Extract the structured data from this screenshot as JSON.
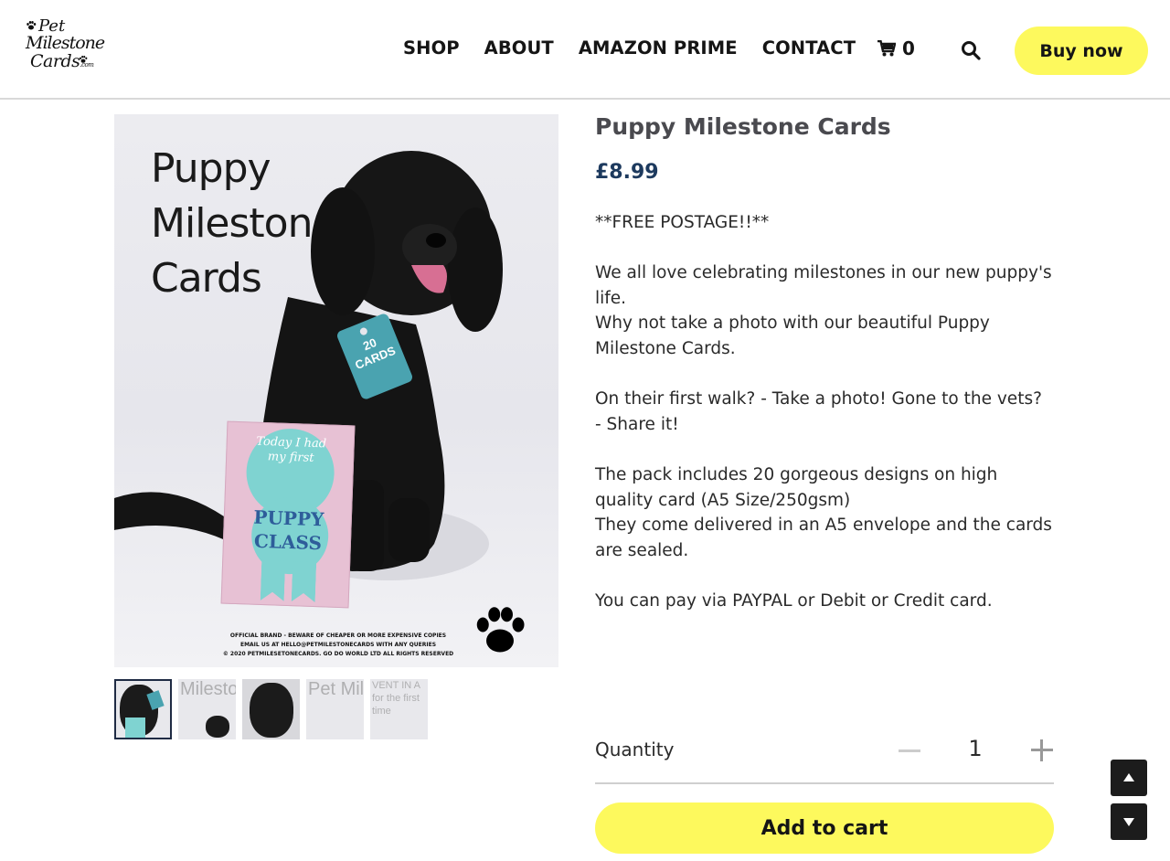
{
  "logo": {
    "line1": "Pet",
    "line2": "Milestone",
    "line3": "Cards",
    "line3_suffix": ".com"
  },
  "nav": {
    "items": [
      "SHOP",
      "ABOUT",
      "AMAZON PRIME",
      "CONTACT"
    ]
  },
  "cart": {
    "count": "0",
    "icon": "cart-icon"
  },
  "search": {
    "icon": "search-icon"
  },
  "header": {
    "buy_now_label": "Buy now"
  },
  "product_image": {
    "title_lines": [
      "Puppy",
      "Milestone",
      "Cards"
    ],
    "tag_text": "20 CARDS",
    "card_badge": "Today I had my first",
    "card_main": "PUPPY CLASS",
    "footer_lines": [
      "OFFICIAL BRAND - BEWARE OF CHEAPER OR MORE EXPENSIVE COPIES",
      "EMAIL US AT HELLO@PETMILESTONECARDS WITH ANY QUERIES",
      "© 2020 PETMILESETONECARDS. GO DO WORLD LTD ALL RIGHTS RESERVED"
    ]
  },
  "thumbnails": [
    {
      "text": ""
    },
    {
      "text": "Milestone Cards"
    },
    {
      "text": ""
    },
    {
      "text": "Pet Milestone Cards"
    },
    {
      "text": "VENT IN A for the first time"
    }
  ],
  "product": {
    "title": "Puppy Milestone Cards",
    "price": "£8.99",
    "description": [
      "**FREE POSTAGE!!**",
      "",
      "We all love celebrating milestones in our new puppy's life.",
      "Why not take a photo with our beautiful Puppy Milestone Cards.",
      "",
      "On their first walk? - Take a photo! Gone to the vets? - Share it!",
      "",
      "The pack includes 20 gorgeous designs on high quality card (A5 Size/250gsm)",
      "They come delivered in an A5 envelope and the cards are sealed.",
      "",
      "You can pay via PAYPAL or Debit or Credit card."
    ]
  },
  "quantity": {
    "label": "Quantity",
    "value": "1"
  },
  "add_to_cart_label": "Add to cart",
  "colors": {
    "accent_yellow": "#fdf95d",
    "price_navy": "#1d3a5e",
    "tag_teal": "#4aa3b0"
  }
}
